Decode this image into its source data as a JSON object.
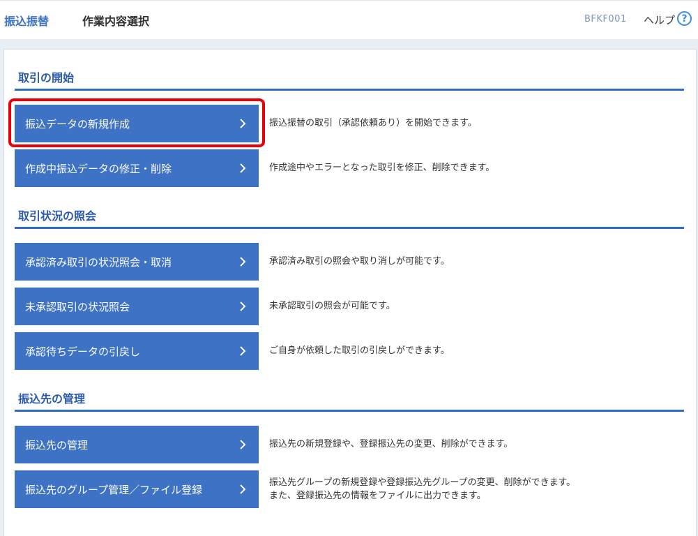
{
  "header": {
    "breadcrumb": "振込振替",
    "title": "作業内容選択",
    "screen_id": "BFKF001",
    "help_label": "ヘルプ",
    "help_icon": "?"
  },
  "sections": [
    {
      "title": "取引の開始",
      "items": [
        {
          "label": "振込データの新規作成",
          "desc": [
            "振込振替の取引（承認依頼あり）を開始できます。"
          ]
        },
        {
          "label": "作成中振込データの修正・削除",
          "desc": [
            "作成途中やエラーとなった取引を修正、削除できます。"
          ]
        }
      ]
    },
    {
      "title": "取引状況の照会",
      "items": [
        {
          "label": "承認済み取引の状況照会・取消",
          "desc": [
            "承認済み取引の照会や取り消しが可能です。"
          ]
        },
        {
          "label": "未承認取引の状況照会",
          "desc": [
            "未承認取引の照会が可能です。"
          ]
        },
        {
          "label": "承認待ちデータの引戻し",
          "desc": [
            "ご自身が依頼した取引の引戻しができます。"
          ]
        }
      ]
    },
    {
      "title": "振込先の管理",
      "items": [
        {
          "label": "振込先の管理",
          "desc": [
            "振込先の新規登録や、登録振込先の変更、削除ができます。"
          ]
        },
        {
          "label": "振込先のグループ管理／ファイル登録",
          "desc": [
            "振込先グループの新規登録や登録振込先グループの変更、削除ができます。",
            "また、登録振込先の情報をファイルに出力できます。"
          ]
        }
      ]
    }
  ],
  "colors": {
    "button_bg": "#3d72c5",
    "section_title": "#2c5aa8",
    "section_rule": "#2f6cc4",
    "highlight_border": "#e8000a"
  },
  "icons": {
    "button_arrow": "chevron-right-icon",
    "help": "question-circle-icon"
  }
}
